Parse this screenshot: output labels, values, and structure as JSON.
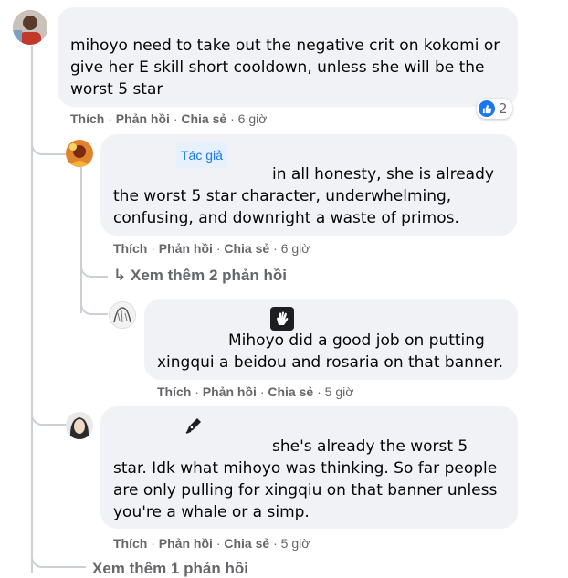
{
  "comments": [
    {
      "text": "mihoyo need to take out the negative crit on kokomi or give her E skill short cooldown, unless she will be the worst 5 star",
      "reaction_count": "2",
      "actions": {
        "like": "Thích",
        "reply": "Phản hồi",
        "share": "Chia sẻ",
        "time": "6 giờ"
      }
    },
    {
      "badge": "Tác giả",
      "text": "in all honesty, she is already the worst 5 star character, underwhelming, confusing, and downright a waste of primos.",
      "actions": {
        "like": "Thích",
        "reply": "Phản hồi",
        "share": "Chia sẻ",
        "time": "6 giờ"
      },
      "more_replies": "Xem thêm 2 phản hồi"
    },
    {
      "text": "Mihoyo did a good job on putting xingqui a beidou and rosaria on that banner.",
      "actions": {
        "like": "Thích",
        "reply": "Phản hồi",
        "share": "Chia sẻ",
        "time": "5 giờ"
      }
    },
    {
      "text": "she's already the worst 5 star. Idk what mihoyo was thinking. So far people are only pulling for xingqiu on that banner unless you're a whale or a simp.",
      "actions": {
        "like": "Thích",
        "reply": "Phản hồi",
        "share": "Chia sẻ",
        "time": "5 giờ"
      },
      "more_replies": "Xem thêm 1 phản hồi"
    }
  ],
  "separator": "·",
  "reply_arrow": "↳",
  "colors": {
    "bubble": "#f0f2f5",
    "secondary_text": "#65676b",
    "like_blue": "#1877f2",
    "thread_line": "#ccd0d5"
  }
}
